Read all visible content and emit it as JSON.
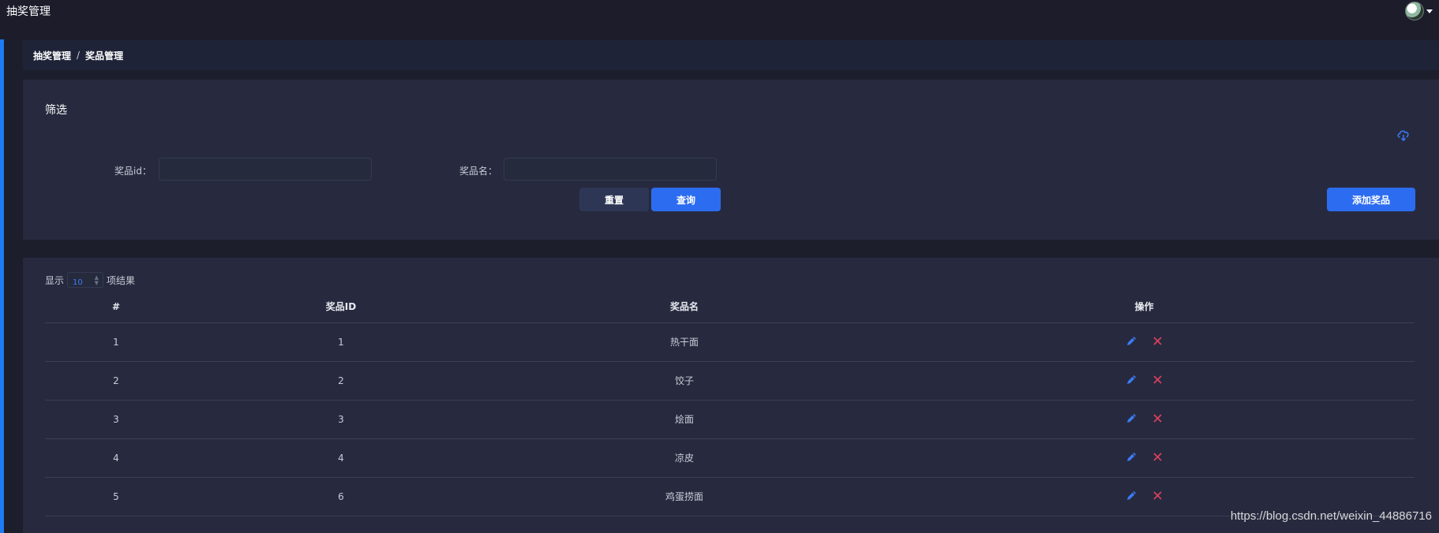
{
  "header": {
    "title": "抽奖管理"
  },
  "breadcrumb": {
    "parent": "抽奖管理",
    "separator": "/",
    "current": "奖品管理"
  },
  "filter": {
    "title": "筛选",
    "prize_id_label": "奖品id：",
    "prize_id_value": "",
    "prize_name_label": "奖品名：",
    "prize_name_value": "",
    "reset_label": "重置",
    "query_label": "查询",
    "add_label": "添加奖品"
  },
  "table": {
    "show_label": "显示",
    "page_size": "10",
    "results_label": "项结果",
    "columns": {
      "num": "#",
      "id": "奖品ID",
      "name": "奖品名",
      "op": "操作"
    },
    "rows": [
      {
        "num": "1",
        "id": "1",
        "name": "热干面"
      },
      {
        "num": "2",
        "id": "2",
        "name": "饺子"
      },
      {
        "num": "3",
        "id": "3",
        "name": "烩面"
      },
      {
        "num": "4",
        "id": "4",
        "name": "凉皮"
      },
      {
        "num": "5",
        "id": "6",
        "name": "鸡蛋捞面"
      }
    ]
  },
  "watermark": "https://blog.csdn.net/weixin_44886716",
  "colors": {
    "accent": "#2c6cf0",
    "danger": "#e0405e",
    "edit": "#3c7bf5"
  },
  "icons": {
    "cloud": "cloud-download-icon",
    "edit": "pencil-icon",
    "delete": "close-icon",
    "avatar": "user-avatar"
  }
}
